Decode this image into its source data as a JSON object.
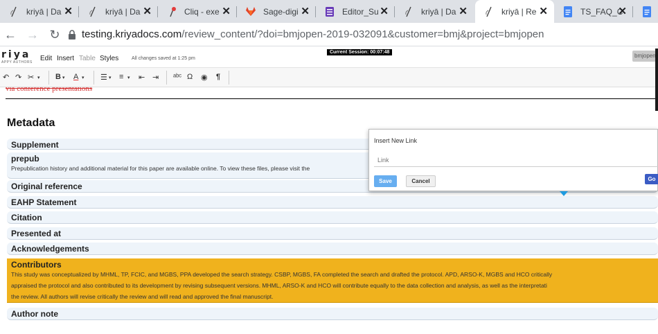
{
  "browser": {
    "tabs": [
      {
        "title": "kriyā | Da",
        "icon": "kriya-icon",
        "active": false
      },
      {
        "title": "kriyā | Da",
        "icon": "kriya-icon",
        "active": false
      },
      {
        "title": "Cliq - exe",
        "icon": "cliq-icon",
        "active": false
      },
      {
        "title": "Sage-digi",
        "icon": "gitlab-icon",
        "active": false
      },
      {
        "title": "Editor_Su",
        "icon": "forms-icon",
        "active": false
      },
      {
        "title": "kriyā | Da",
        "icon": "kriya-icon",
        "active": false
      },
      {
        "title": "kriyā | Re",
        "icon": "kriya-icon",
        "active": true
      },
      {
        "title": "TS_FAQ_C",
        "icon": "docs-icon",
        "active": false
      },
      {
        "title": "",
        "icon": "docs-icon",
        "active": false
      }
    ],
    "url_host": "testing.kriyadocs.com",
    "url_path": "/review_content/?doi=bmjopen-2019-032091&customer=bmj&project=bmjopen"
  },
  "app": {
    "logo": "riya",
    "logo_tagline": "APPY AUTHORS",
    "menu": [
      "Edit",
      "Insert",
      "Table",
      "Styles"
    ],
    "saved_status": "All changes saved at 1:25 pm",
    "session": "Current Session: 00:07:48",
    "user": "bmjopen"
  },
  "content": {
    "struck_text": "via conference presentations",
    "heading": "Metadata",
    "sections": [
      {
        "title": "Supplement",
        "desc": ""
      },
      {
        "title": "prepub",
        "desc": "Prepublication history and additional material for this paper are available online. To view these files, please visit the"
      },
      {
        "title": "Original reference",
        "desc": ""
      },
      {
        "title": "EAHP Statement",
        "desc": ""
      },
      {
        "title": "Citation",
        "desc": ""
      },
      {
        "title": "Presented at",
        "desc": ""
      },
      {
        "title": "Acknowledgements",
        "desc": ""
      },
      {
        "title": "Contributors",
        "desc_lines": [
          "This study was conceptualized by MHML, TP, FCIC, and MGBS, PPA developed the search strategy. CSBP, MGBS, FA completed the search and drafted the protocol. APD, ARSO-K, MGBS and HCO critically",
          "appraised the protocol and also contributed to its development by revising subsequent versions. MHML, ARSO-K and HCO will contribute equally to the data collection and analysis, as well as the interpretati",
          "the review. All authors will revise critically the review and will read and approved the final manuscript."
        ]
      },
      {
        "title": "Author note",
        "desc": ""
      }
    ]
  },
  "popup": {
    "title": "Insert New Link",
    "link_placeholder": "Link",
    "save_label": "Save",
    "cancel_label": "Cancel",
    "go_label": "Go"
  },
  "colors": {
    "contributors_bg": "#f0b21d",
    "section_bg": "#eef4fa",
    "save_button": "#67aef0"
  }
}
